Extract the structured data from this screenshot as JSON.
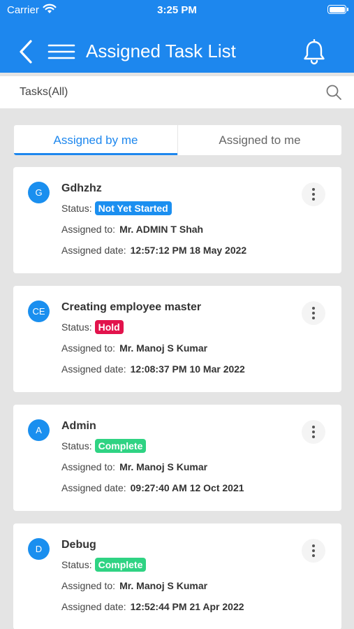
{
  "status_bar": {
    "carrier": "Carrier",
    "time": "3:25 PM"
  },
  "header": {
    "title": "Assigned Task List"
  },
  "search": {
    "label": "Tasks(All)"
  },
  "tabs": [
    {
      "label": "Assigned by me",
      "active": true
    },
    {
      "label": "Assigned to me",
      "active": false
    }
  ],
  "labels": {
    "status": "Status:",
    "assigned_to": "Assigned to:",
    "assigned_date": "Assigned date:"
  },
  "colors": {
    "primary": "#1d87ee",
    "not_yet_started": "#1b8ff0",
    "hold": "#e2134c",
    "complete": "#2fd383"
  },
  "tasks": [
    {
      "initials": "G",
      "title": "Gdhzhz",
      "status": "Not Yet Started",
      "status_color": "#1b8ff0",
      "assigned_to": "Mr. ADMIN T Shah",
      "assigned_date": "12:57:12 PM 18 May 2022"
    },
    {
      "initials": "CE",
      "title": "Creating employee master",
      "status": "Hold",
      "status_color": "#e2134c",
      "assigned_to": "Mr. Manoj S Kumar",
      "assigned_date": "12:08:37 PM 10 Mar 2022"
    },
    {
      "initials": "A",
      "title": "Admin",
      "status": "Complete",
      "status_color": "#2fd383",
      "assigned_to": "Mr. Manoj S Kumar",
      "assigned_date": "09:27:40 AM 12 Oct 2021"
    },
    {
      "initials": "D",
      "title": "Debug",
      "status": "Complete",
      "status_color": "#2fd383",
      "assigned_to": "Mr. Manoj S Kumar",
      "assigned_date": "12:52:44 PM 21 Apr 2022"
    }
  ]
}
